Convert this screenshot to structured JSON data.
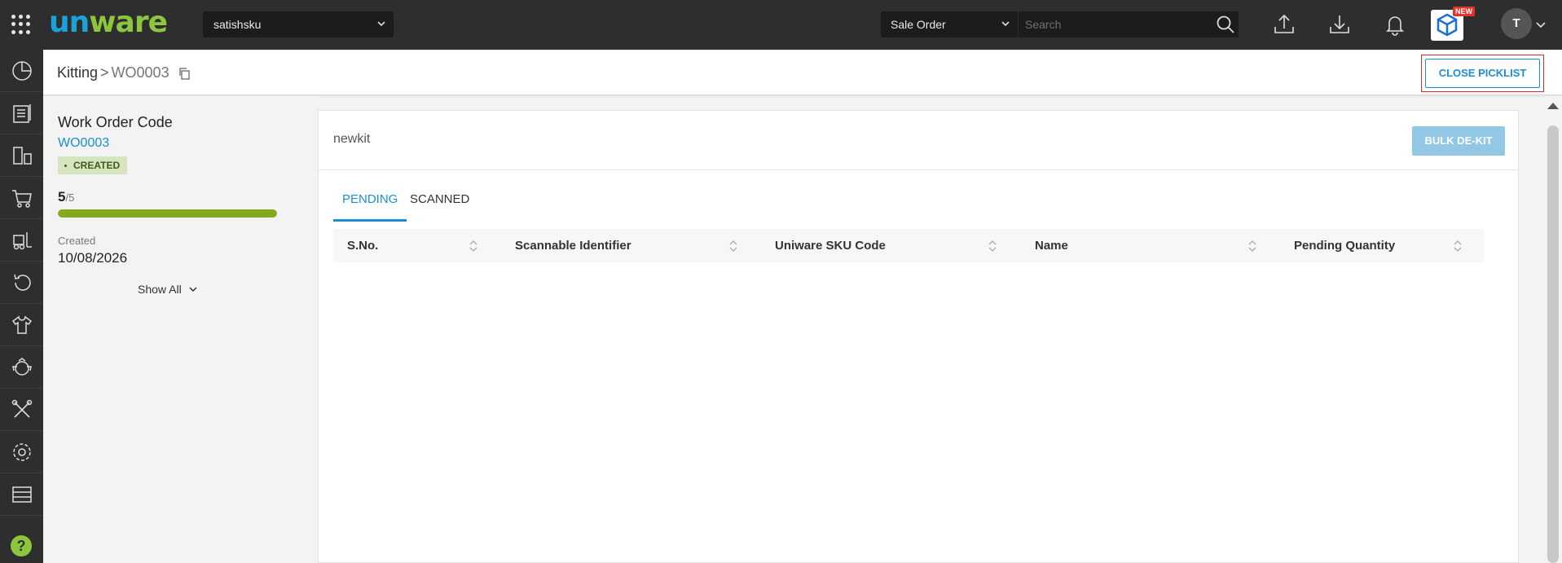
{
  "header": {
    "brand": {
      "part1": "un",
      "part2": "ware"
    },
    "facility_dropdown": "satishsku",
    "search_type": "Sale Order",
    "search_placeholder": "Search",
    "new_badge": "NEW",
    "avatar_initial": "T"
  },
  "breadcrumb": {
    "parent": "Kitting",
    "separator": ">",
    "current": "WO0003"
  },
  "actions": {
    "close_picklist": "CLOSE PICKLIST",
    "bulk_dekit": "BULK DE-KIT"
  },
  "work_order": {
    "label": "Work Order Code",
    "code": "WO0003",
    "status": "CREATED",
    "progress_done": "5",
    "progress_total": "/5",
    "progress_fraction": 1.0,
    "created_label": "Created",
    "created_value": "10/08/2026",
    "show_all": "Show All"
  },
  "kit": {
    "name": "newkit",
    "tabs": [
      {
        "label": "PENDING",
        "active": true
      },
      {
        "label": "SCANNED",
        "active": false
      }
    ],
    "columns": [
      "S.No.",
      "Scannable Identifier",
      "Uniware SKU Code",
      "Name",
      "Pending Quantity"
    ]
  },
  "sidebar": {
    "items": [
      "dashboard-icon",
      "orders-icon",
      "inventory-icon",
      "cart-icon",
      "forklift-icon",
      "returns-icon",
      "shirt-icon",
      "recycle-icon",
      "tools-icon",
      "settings-icon",
      "warehouse-icon",
      "help-icon"
    ]
  },
  "colors": {
    "accent": "#1a8fd4",
    "brand_green": "#8cc63f",
    "progress": "#86a91c",
    "topbar": "#2e2e2e",
    "highlight_border": "#e0282f"
  }
}
